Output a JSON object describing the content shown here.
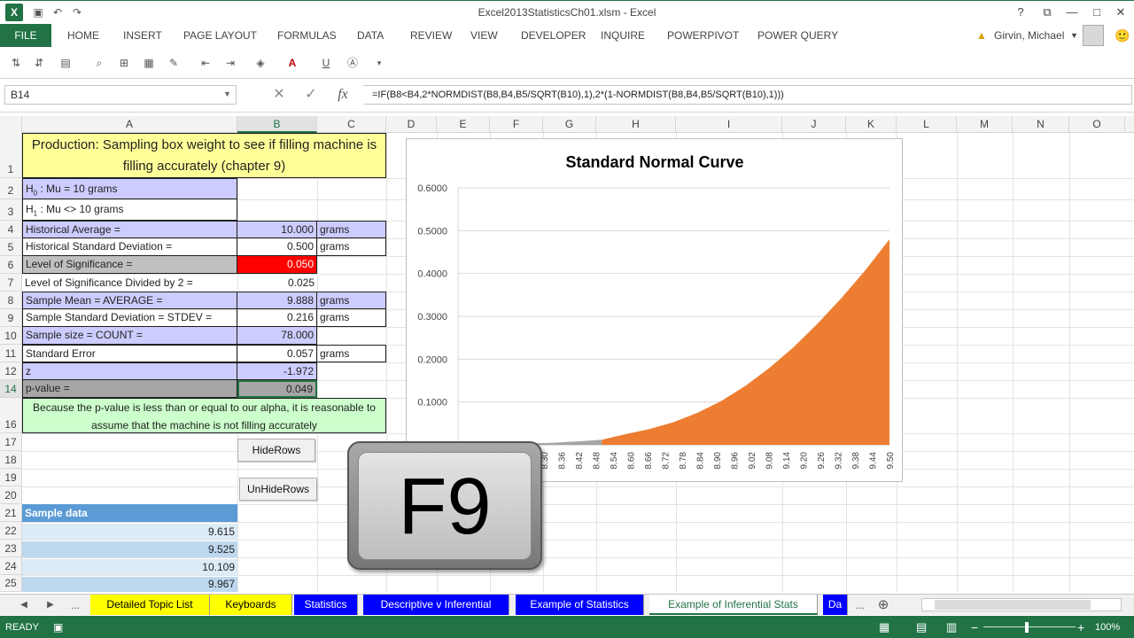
{
  "title_bar": {
    "title": "Excel2013StatisticsCh01.xlsm - Excel",
    "app_icon": "X",
    "help": "?",
    "restore_ribbon": "⧉",
    "minimize": "—",
    "maximize": "□",
    "close": "✕"
  },
  "ribbon": {
    "file_label": "FILE",
    "tabs": [
      "HOME",
      "INSERT",
      "PAGE LAYOUT",
      "FORMULAS",
      "DATA",
      "REVIEW",
      "VIEW",
      "DEVELOPER",
      "INQUIRE",
      "POWERPIVOT",
      "POWER QUERY"
    ],
    "user_name": "Girvin, Michael",
    "smiley": "🙂"
  },
  "formula_bar": {
    "name_box": "B14",
    "cancel": "✕",
    "enter": "✓",
    "fx": "fx",
    "formula": "=IF(B8<B4,2*NORMDIST(B8,B4,B5/SQRT(B10),1),2*(1-NORMDIST(B8,B4,B5/SQRT(B10),1)))"
  },
  "columns": [
    "A",
    "B",
    "C",
    "D",
    "E",
    "F",
    "G",
    "H",
    "I",
    "J",
    "K",
    "L",
    "M",
    "N",
    "O"
  ],
  "rows": [
    "1",
    "2",
    "3",
    "4",
    "5",
    "6",
    "7",
    "8",
    "9",
    "10",
    "11",
    "12",
    "14",
    "16",
    "17",
    "18",
    "19",
    "20",
    "21",
    "22",
    "23",
    "24",
    "25"
  ],
  "sheet": {
    "title": "Production: Sampling box weight to see if filling machine is filling accurately (chapter 9)",
    "h0": {
      "h": "H",
      "sub": "0",
      "rest": " : Mu = 10 grams"
    },
    "h1": {
      "h": "H",
      "sub": "1",
      "rest": " : Mu <> 10 grams"
    },
    "r4": {
      "label": "Historical Average =",
      "value": "10.000",
      "unit": "grams"
    },
    "r5": {
      "label": "Historical Standard Deviation =",
      "value": "0.500",
      "unit": "grams"
    },
    "r6": {
      "label": "Level of Significance =",
      "value": "0.050"
    },
    "r7": {
      "label": "Level of Significance Divided by 2 =",
      "value": "0.025"
    },
    "r8": {
      "label": "Sample Mean = AVERAGE =",
      "value": "9.888",
      "unit": "grams"
    },
    "r9": {
      "label": "Sample Standard Deviation = STDEV =",
      "value": "0.216",
      "unit": "grams"
    },
    "r10": {
      "label": "Sample size = COUNT =",
      "value": "78.000"
    },
    "r11": {
      "label": "Standard Error",
      "value": "0.057",
      "unit": "grams"
    },
    "r12": {
      "label": "z",
      "value": "-1.972"
    },
    "r14": {
      "label": "p-value =",
      "value": "0.049"
    },
    "note": "Because the p-value is less than or equal to our alpha, it is reasonable to assume that the machine is not filling accurately",
    "btn_hide": "HideRows",
    "btn_unhide": "UnHideRows",
    "sample_header": "Sample data",
    "samples": [
      "9.615",
      "9.525",
      "10.109",
      "9.967"
    ]
  },
  "chart_data": {
    "type": "area",
    "title": "Standard Normal Curve",
    "yticks": [
      "0.6000",
      "0.5000",
      "0.4000",
      "0.3000",
      "0.2000",
      "0.1000"
    ],
    "ylim": [
      0,
      0.6
    ],
    "xticks": [
      "8.30",
      "8.36",
      "8.42",
      "8.48",
      "8.54",
      "8.60",
      "8.66",
      "8.72",
      "8.78",
      "8.84",
      "8.90",
      "8.96",
      "9.02",
      "9.08",
      "9.14",
      "9.20",
      "9.26",
      "9.32",
      "9.38",
      "9.44",
      "9.50"
    ],
    "series": [
      {
        "values": [
          0.001,
          0.001,
          0.002,
          0.003,
          0.005,
          0.008,
          0.012,
          0.025,
          0.037,
          0.053,
          0.075,
          0.103,
          0.138,
          0.18,
          0.228,
          0.283,
          0.343,
          0.408,
          0.48
        ]
      }
    ],
    "colors": {
      "tail": "#a5a5a5",
      "body": "#ed7d31"
    },
    "grid": true,
    "legend": "none"
  },
  "key_overlay": {
    "label": "F9"
  },
  "sheet_tabs": {
    "nav_prev": "◀",
    "nav_next": "▶",
    "ellipsis": "...",
    "ellipsis_right": "...",
    "add": "⊕",
    "tabs": [
      {
        "label": "Detailed Topic List"
      },
      {
        "label": "Keyboards"
      },
      {
        "label": "Statistics"
      },
      {
        "label": "Descriptive v Inferential"
      },
      {
        "label": "Example of Statistics"
      },
      {
        "label": "Example of Inferential Stats"
      },
      {
        "label": "Da"
      }
    ]
  },
  "status_bar": {
    "ready": "READY",
    "zoom": "100%",
    "minus": "−",
    "plus": "+"
  }
}
